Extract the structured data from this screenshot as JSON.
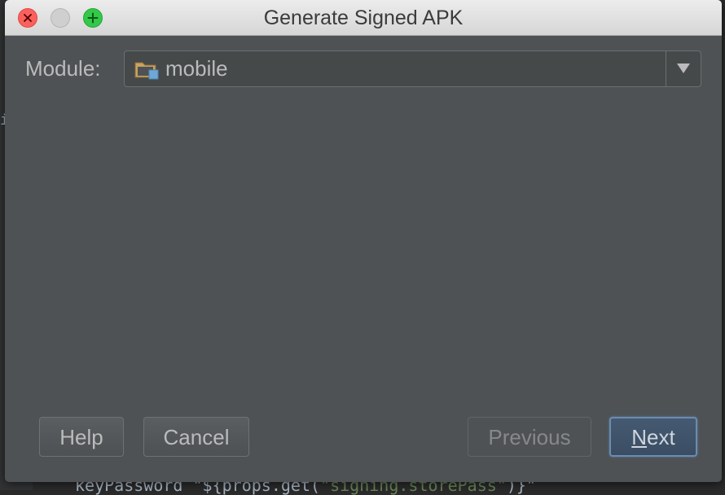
{
  "window": {
    "title": "Generate Signed APK"
  },
  "module": {
    "label": "Module:",
    "value": "mobile",
    "icon": "folder-module-icon"
  },
  "buttons": {
    "help": "Help",
    "cancel": "Cancel",
    "previous": "Previous",
    "next_mnemonic": "N",
    "next_rest": "ext"
  },
  "background": {
    "code_prefix": "keyPassword \"${props.get(",
    "code_string": "\"signing.storePass\"",
    "code_suffix": ")}\"",
    "code_fragment": "i"
  },
  "colors": {
    "dialog_bg": "#4e5254",
    "text": "#bbbbbb",
    "default_button_border": "#6b8cb1",
    "close": "#fc605c",
    "maximize": "#34c84a"
  }
}
